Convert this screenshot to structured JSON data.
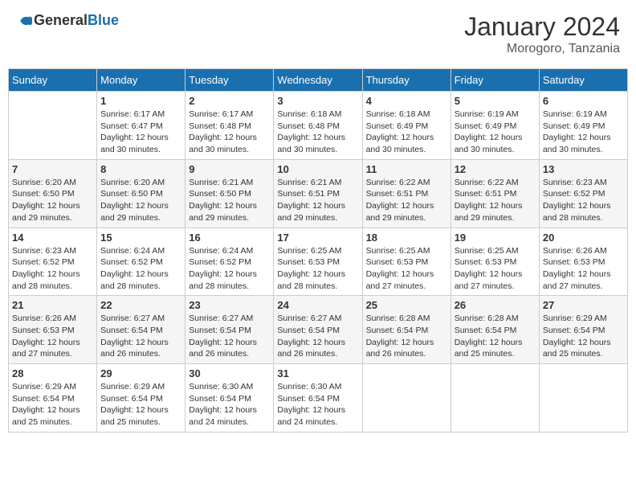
{
  "header": {
    "logo_general": "General",
    "logo_blue": "Blue",
    "month_year": "January 2024",
    "location": "Morogoro, Tanzania"
  },
  "days_of_week": [
    "Sunday",
    "Monday",
    "Tuesday",
    "Wednesday",
    "Thursday",
    "Friday",
    "Saturday"
  ],
  "weeks": [
    [
      {
        "day": "",
        "info": ""
      },
      {
        "day": "1",
        "info": "Sunrise: 6:17 AM\nSunset: 6:47 PM\nDaylight: 12 hours\nand 30 minutes."
      },
      {
        "day": "2",
        "info": "Sunrise: 6:17 AM\nSunset: 6:48 PM\nDaylight: 12 hours\nand 30 minutes."
      },
      {
        "day": "3",
        "info": "Sunrise: 6:18 AM\nSunset: 6:48 PM\nDaylight: 12 hours\nand 30 minutes."
      },
      {
        "day": "4",
        "info": "Sunrise: 6:18 AM\nSunset: 6:49 PM\nDaylight: 12 hours\nand 30 minutes."
      },
      {
        "day": "5",
        "info": "Sunrise: 6:19 AM\nSunset: 6:49 PM\nDaylight: 12 hours\nand 30 minutes."
      },
      {
        "day": "6",
        "info": "Sunrise: 6:19 AM\nSunset: 6:49 PM\nDaylight: 12 hours\nand 30 minutes."
      }
    ],
    [
      {
        "day": "7",
        "info": "Sunrise: 6:20 AM\nSunset: 6:50 PM\nDaylight: 12 hours\nand 29 minutes."
      },
      {
        "day": "8",
        "info": "Sunrise: 6:20 AM\nSunset: 6:50 PM\nDaylight: 12 hours\nand 29 minutes."
      },
      {
        "day": "9",
        "info": "Sunrise: 6:21 AM\nSunset: 6:50 PM\nDaylight: 12 hours\nand 29 minutes."
      },
      {
        "day": "10",
        "info": "Sunrise: 6:21 AM\nSunset: 6:51 PM\nDaylight: 12 hours\nand 29 minutes."
      },
      {
        "day": "11",
        "info": "Sunrise: 6:22 AM\nSunset: 6:51 PM\nDaylight: 12 hours\nand 29 minutes."
      },
      {
        "day": "12",
        "info": "Sunrise: 6:22 AM\nSunset: 6:51 PM\nDaylight: 12 hours\nand 29 minutes."
      },
      {
        "day": "13",
        "info": "Sunrise: 6:23 AM\nSunset: 6:52 PM\nDaylight: 12 hours\nand 28 minutes."
      }
    ],
    [
      {
        "day": "14",
        "info": "Sunrise: 6:23 AM\nSunset: 6:52 PM\nDaylight: 12 hours\nand 28 minutes."
      },
      {
        "day": "15",
        "info": "Sunrise: 6:24 AM\nSunset: 6:52 PM\nDaylight: 12 hours\nand 28 minutes."
      },
      {
        "day": "16",
        "info": "Sunrise: 6:24 AM\nSunset: 6:52 PM\nDaylight: 12 hours\nand 28 minutes."
      },
      {
        "day": "17",
        "info": "Sunrise: 6:25 AM\nSunset: 6:53 PM\nDaylight: 12 hours\nand 28 minutes."
      },
      {
        "day": "18",
        "info": "Sunrise: 6:25 AM\nSunset: 6:53 PM\nDaylight: 12 hours\nand 27 minutes."
      },
      {
        "day": "19",
        "info": "Sunrise: 6:25 AM\nSunset: 6:53 PM\nDaylight: 12 hours\nand 27 minutes."
      },
      {
        "day": "20",
        "info": "Sunrise: 6:26 AM\nSunset: 6:53 PM\nDaylight: 12 hours\nand 27 minutes."
      }
    ],
    [
      {
        "day": "21",
        "info": "Sunrise: 6:26 AM\nSunset: 6:53 PM\nDaylight: 12 hours\nand 27 minutes."
      },
      {
        "day": "22",
        "info": "Sunrise: 6:27 AM\nSunset: 6:54 PM\nDaylight: 12 hours\nand 26 minutes."
      },
      {
        "day": "23",
        "info": "Sunrise: 6:27 AM\nSunset: 6:54 PM\nDaylight: 12 hours\nand 26 minutes."
      },
      {
        "day": "24",
        "info": "Sunrise: 6:27 AM\nSunset: 6:54 PM\nDaylight: 12 hours\nand 26 minutes."
      },
      {
        "day": "25",
        "info": "Sunrise: 6:28 AM\nSunset: 6:54 PM\nDaylight: 12 hours\nand 26 minutes."
      },
      {
        "day": "26",
        "info": "Sunrise: 6:28 AM\nSunset: 6:54 PM\nDaylight: 12 hours\nand 25 minutes."
      },
      {
        "day": "27",
        "info": "Sunrise: 6:29 AM\nSunset: 6:54 PM\nDaylight: 12 hours\nand 25 minutes."
      }
    ],
    [
      {
        "day": "28",
        "info": "Sunrise: 6:29 AM\nSunset: 6:54 PM\nDaylight: 12 hours\nand 25 minutes."
      },
      {
        "day": "29",
        "info": "Sunrise: 6:29 AM\nSunset: 6:54 PM\nDaylight: 12 hours\nand 25 minutes."
      },
      {
        "day": "30",
        "info": "Sunrise: 6:30 AM\nSunset: 6:54 PM\nDaylight: 12 hours\nand 24 minutes."
      },
      {
        "day": "31",
        "info": "Sunrise: 6:30 AM\nSunset: 6:54 PM\nDaylight: 12 hours\nand 24 minutes."
      },
      {
        "day": "",
        "info": ""
      },
      {
        "day": "",
        "info": ""
      },
      {
        "day": "",
        "info": ""
      }
    ]
  ]
}
